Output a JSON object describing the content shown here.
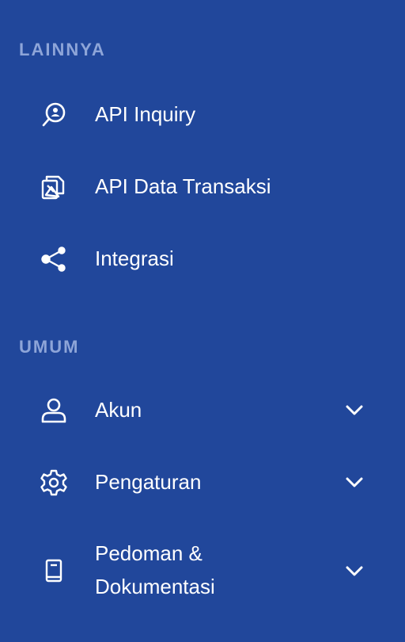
{
  "sections": [
    {
      "label": "LAINNYA",
      "items": [
        {
          "label": "API Inquiry",
          "icon": "search-user-icon"
        },
        {
          "label": "API Data Transaksi",
          "icon": "documents-icon"
        },
        {
          "label": "Integrasi",
          "icon": "share-icon"
        }
      ]
    },
    {
      "label": "UMUM",
      "items": [
        {
          "label": "Akun",
          "icon": "user-icon",
          "expandable": true
        },
        {
          "label": "Pengaturan",
          "icon": "gear-icon",
          "expandable": true
        },
        {
          "label_line1": "Pedoman &",
          "label_line2": "Dokumentasi",
          "icon": "book-icon",
          "expandable": true
        }
      ]
    }
  ],
  "colors": {
    "background": "#21479b",
    "section_label": "#8ea5d8",
    "text": "#ffffff"
  }
}
